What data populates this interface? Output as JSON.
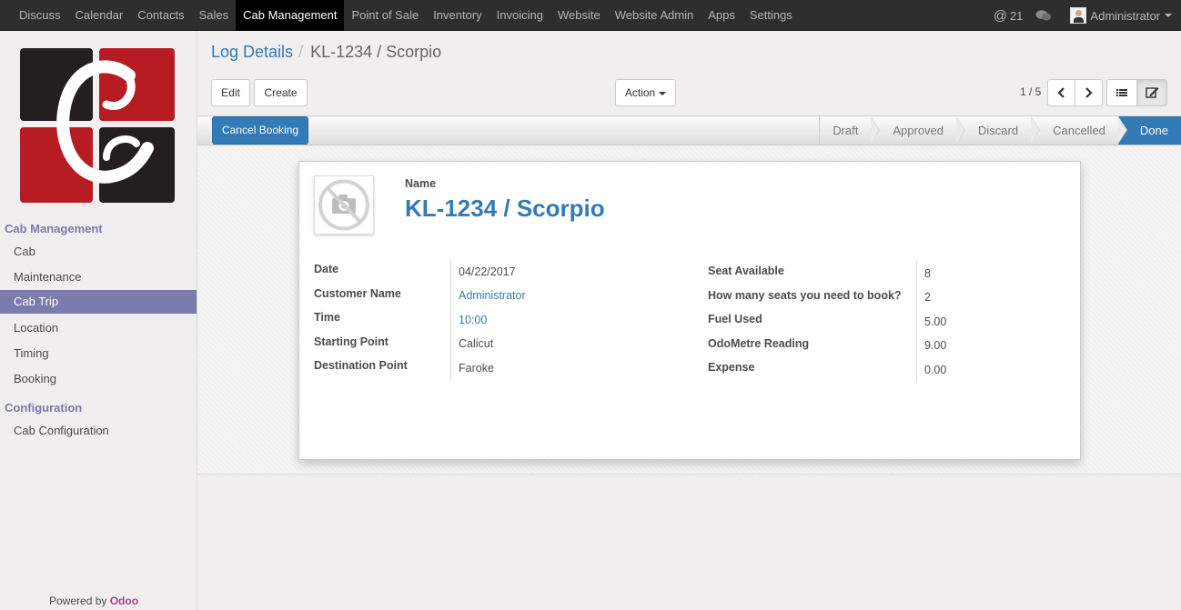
{
  "topbar": {
    "menu": [
      "Discuss",
      "Calendar",
      "Contacts",
      "Sales",
      "Cab Management",
      "Point of Sale",
      "Inventory",
      "Invoicing",
      "Website",
      "Website Admin",
      "Apps",
      "Settings"
    ],
    "active_index": 4,
    "notification_count": "21",
    "user": "Administrator"
  },
  "sidebar": {
    "section1": "Cab Management",
    "items1": [
      "Cab",
      "Maintenance",
      "Cab Trip",
      "Location",
      "Timing",
      "Booking"
    ],
    "active_item": "Cab Trip",
    "section2": "Configuration",
    "items2": [
      "Cab Configuration"
    ],
    "powered_by": "Powered by",
    "brand": "Odoo"
  },
  "breadcrumb": {
    "parent": "Log Details",
    "separator": "/",
    "current": "KL-1234 / Scorpio"
  },
  "toolbar": {
    "edit": "Edit",
    "create": "Create",
    "action": "Action",
    "pager": "1 / 5"
  },
  "statusbar": {
    "cancel_button": "Cancel Booking",
    "stages": [
      "Draft",
      "Approved",
      "Discard",
      "Cancelled",
      "Done"
    ],
    "current_stage": "Done"
  },
  "form": {
    "name_label": "Name",
    "name_value": "KL-1234 / Scorpio",
    "left": [
      {
        "label": "Date",
        "value": "04/22/2017",
        "link": false
      },
      {
        "label": "Customer Name",
        "value": "Administrator",
        "link": true
      },
      {
        "label": "Time",
        "value": "10:00",
        "link": true
      },
      {
        "label": "Starting Point",
        "value": "Calicut",
        "link": false
      },
      {
        "label": "Destination Point",
        "value": "Faroke",
        "link": false
      }
    ],
    "right": [
      {
        "label": "Seat Available",
        "value": "8"
      },
      {
        "label": "How many seats you need to book?",
        "value": "2"
      },
      {
        "label": "Fuel Used",
        "value": "5.00"
      },
      {
        "label": "OdoMetre Reading",
        "value": "9.00"
      },
      {
        "label": "Expense",
        "value": "0.00"
      }
    ]
  },
  "colors": {
    "primary": "#337ab7",
    "sidebar_accent": "#7c7bad",
    "topbar": "#2e2e2e",
    "logo_red": "#b71c22",
    "logo_dark": "#231f20"
  }
}
